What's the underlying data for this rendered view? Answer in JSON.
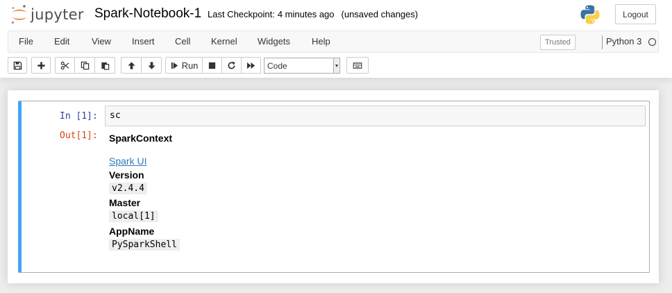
{
  "header": {
    "logo_text": "jupyter",
    "notebook_name": "Spark-Notebook-1",
    "checkpoint_label": "Last Checkpoint:",
    "checkpoint_time": "4 minutes ago",
    "unsaved": "(unsaved changes)",
    "logout_label": "Logout"
  },
  "menubar": {
    "items": [
      "File",
      "Edit",
      "View",
      "Insert",
      "Cell",
      "Kernel",
      "Widgets",
      "Help"
    ],
    "trusted_label": "Trusted",
    "kernel_name": "Python 3"
  },
  "toolbar": {
    "run_label": "Run",
    "cell_type": "Code",
    "icons": [
      "save-icon",
      "plus-icon",
      "cut-icon",
      "copy-icon",
      "paste-icon",
      "arrow-up-icon",
      "arrow-down-icon",
      "step-forward-icon",
      "stop-icon",
      "redo-icon",
      "fast-forward-icon",
      "keyboard-icon"
    ]
  },
  "cell": {
    "in_prompt": "In [1]:",
    "input": "sc",
    "out_prompt": "Out[1]:",
    "output": {
      "title": "SparkContext",
      "link": "Spark UI",
      "version_label": "Version",
      "version_value": "v2.4.4",
      "master_label": "Master",
      "master_value": "local[1]",
      "appname_label": "AppName",
      "appname_value": "PySparkShell"
    }
  },
  "colors": {
    "accent": "#42a5f5",
    "in_prompt": "#303f9f",
    "out_prompt": "#d84315",
    "link": "#337ab7",
    "logo_orange": "#f37726"
  }
}
